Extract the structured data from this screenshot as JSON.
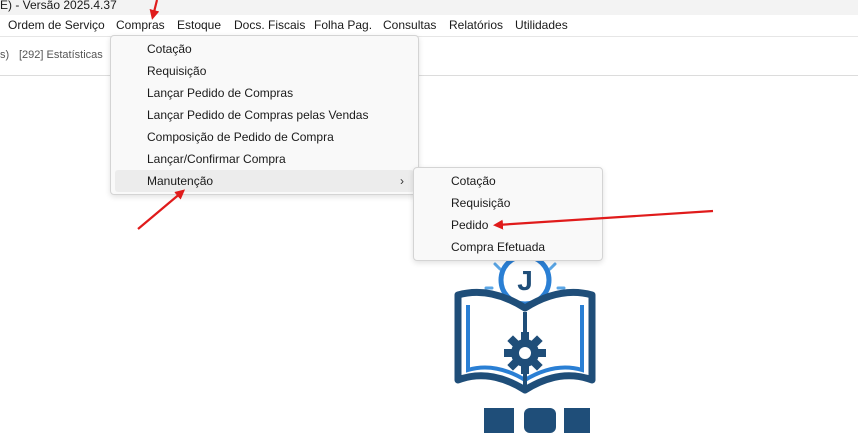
{
  "window": {
    "title": "E) - Versão 2025.4.37"
  },
  "menubar": {
    "items": [
      {
        "id": "ordem",
        "label": "Ordem de Serviço"
      },
      {
        "id": "compras",
        "label": "Compras"
      },
      {
        "id": "estoque",
        "label": "Estoque"
      },
      {
        "id": "docs",
        "label": "Docs. Fiscais"
      },
      {
        "id": "folha",
        "label": "Folha Pag."
      },
      {
        "id": "consultas",
        "label": "Consultas"
      },
      {
        "id": "relatorios",
        "label": "Relatórios"
      },
      {
        "id": "utilidades",
        "label": "Utilidades"
      }
    ]
  },
  "tabs": {
    "partial": "s)",
    "estatisticas": "[292] Estatísticas"
  },
  "compras_menu": {
    "items": [
      {
        "label": "Cotação"
      },
      {
        "label": "Requisição"
      },
      {
        "label": "Lançar Pedido de Compras"
      },
      {
        "label": "Lançar Pedido de Compras pelas Vendas"
      },
      {
        "label": "Composição de Pedido de Compra"
      },
      {
        "label": "Lançar/Confirmar Compra"
      },
      {
        "label": "Manutenção",
        "has_submenu": true,
        "highlighted": true,
        "submenu_arrow": "›"
      }
    ]
  },
  "manutencao_submenu": {
    "items": [
      {
        "label": "Cotação"
      },
      {
        "label": "Requisição"
      },
      {
        "label": "Pedido"
      },
      {
        "label": "Compra Efetuada"
      }
    ]
  },
  "logo": {
    "letter": "J",
    "colors": {
      "primary": "#1f4e79",
      "accent": "#2a7fd4",
      "light": "#5aa6e6"
    }
  },
  "annotation": {
    "arrow_color": "#e01b1b"
  },
  "colors": {
    "menu_bg": "#f9f9f9",
    "hover_bg": "#ececec",
    "tab_text": "#555555"
  }
}
